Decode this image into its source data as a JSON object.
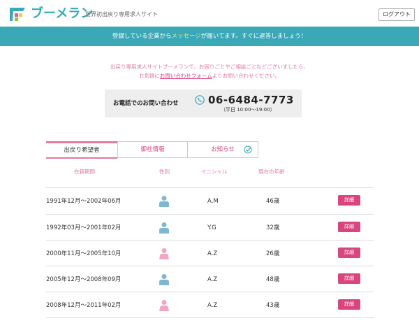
{
  "header": {
    "logo_text": "ブーメラン",
    "tagline": "世界初出戻り専用求人サイト",
    "logout_label": "ログアウト"
  },
  "notice": {
    "before": "登録している企業から",
    "highlight": "メッセージ",
    "after": "が届いてます。すぐに返答しましょう！"
  },
  "contact": {
    "line1": "出戻り専用求人サイトブーメランで、お困りごとやご相談ごとなどございましたら、",
    "line2_before": "お気軽に",
    "line2_link": "お問い合わせフォーム",
    "line2_after": "よりお問い合わせください。",
    "phone_label": "お電話でのお問い合わせ",
    "phone_number": "06-6484-7773",
    "phone_hours": "（平日 10:00～19:00）"
  },
  "tabs": [
    {
      "label": "出戻り希望者"
    },
    {
      "label": "御社情報"
    },
    {
      "label": "お知らせ"
    }
  ],
  "table": {
    "headers": [
      "在籍期間",
      "性別",
      "イニシャル",
      "現在の年齢"
    ],
    "detail_label": "詳細",
    "rows": [
      {
        "period": "1991年12月～2002年06月",
        "gender": "male",
        "initials": "A.M",
        "age": "46歳"
      },
      {
        "period": "1992年03月～2001年02月",
        "gender": "male",
        "initials": "Y.G",
        "age": "32歳"
      },
      {
        "period": "2000年11月～2005年10月",
        "gender": "female",
        "initials": "A.Z",
        "age": "26歳"
      },
      {
        "period": "2005年12月～2008年09月",
        "gender": "male",
        "initials": "A.Z",
        "age": "48歳"
      },
      {
        "period": "2008年12月～2011年02月",
        "gender": "female",
        "initials": "A.Z",
        "age": "43歳"
      }
    ]
  },
  "colors": {
    "brand_teal": "#3aa8b7",
    "accent_pink": "#d9467f",
    "male_icon": "#7fb7d3",
    "female_icon": "#f0a6c4",
    "notice_highlight": "#f2e26a"
  }
}
